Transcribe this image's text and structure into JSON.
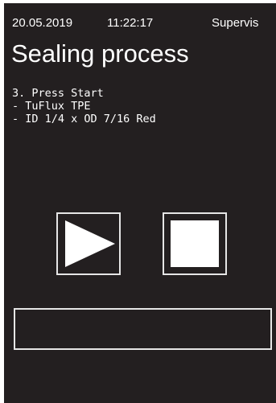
{
  "status_bar": {
    "date": "20.05.2019",
    "time": "11:22:17",
    "user": "Supervis"
  },
  "page": {
    "title": "Sealing process"
  },
  "instructions": [
    "3. Press Start",
    "- TuFlux TPE",
    "- ID 1/4 x OD 7/16 Red"
  ],
  "controls": {
    "play_icon": "play-icon",
    "stop_icon": "stop-icon"
  },
  "progress": {
    "fraction": 0.0
  },
  "colors": {
    "background": "#231f20",
    "foreground": "#ffffff",
    "frame": "#e6e6e6"
  }
}
